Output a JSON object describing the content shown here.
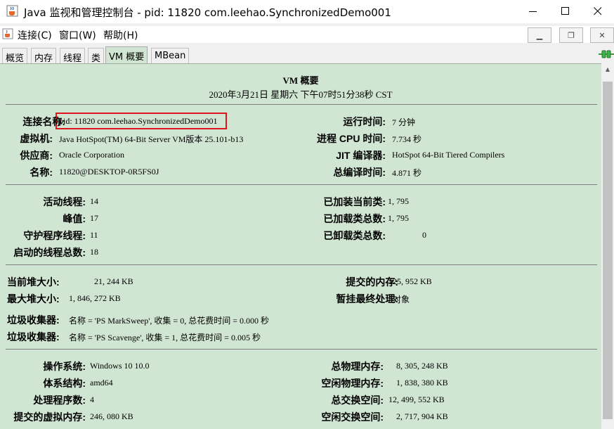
{
  "window": {
    "title": "Java 监视和管理控制台 - pid: 11820 com.leehao.SynchronizedDemo001"
  },
  "menu": {
    "connect": "连接(C)",
    "window": "窗口(W)",
    "help": "帮助(H)"
  },
  "tabs": [
    "概览",
    "内存",
    "线程",
    "类",
    "VM 概要",
    "MBean"
  ],
  "header": {
    "title": "VM 概要",
    "timestamp": "2020年3月21日 星期六 下午07时51分38秒 CST"
  },
  "vm": {
    "connection_label": "连接名称:",
    "connection": "pid: 11820 com.leehao.SynchronizedDemo001",
    "jvm_label": "虚拟机:",
    "jvm": "Java HotSpot(TM) 64-Bit Server VM版本 25.101-b13",
    "vendor_label": "供应商:",
    "vendor": "Oracle Corporation",
    "name_label": "名称:",
    "name": "11820@DESKTOP-0R5FS0J",
    "uptime_label": "运行时间:",
    "uptime": "7 分钟",
    "cpu_label": "进程 CPU 时间:",
    "cpu": "7.734 秒",
    "jit_label": "JIT 编译器:",
    "jit": "HotSpot 64-Bit Tiered Compilers",
    "compile_label": "总编译时间:",
    "compile": "4.871 秒"
  },
  "threads": {
    "live_label": "活动线程:",
    "live": "14",
    "peak_label": "峰值:",
    "peak": "17",
    "daemon_label": "守护程序线程:",
    "daemon": "11",
    "started_label": "启动的线程总数:",
    "started": "18",
    "loaded_label": "已加装当前类:",
    "loaded": "1, 795",
    "total_loaded_label": "已加载类总数:",
    "total_loaded": "1, 795",
    "unloaded_label": "已卸载类总数:",
    "unloaded": "0"
  },
  "memory": {
    "heap_label": "当前堆大小:",
    "heap": "21, 244 KB",
    "max_heap_label": "最大堆大小:",
    "max_heap": "1, 846, 272 KB",
    "committed_label": "提交的内存:",
    "committed": "125, 952 KB",
    "pending_label": "暂挂最终处理:",
    "pending": "0对象",
    "gc1_label": "垃圾收集器:",
    "gc1": "名称 = 'PS MarkSweep', 收集 = 0, 总花费时间 = 0.000 秒",
    "gc2_label": "垃圾收集器:",
    "gc2": "名称 = 'PS Scavenge', 收集 = 1, 总花费时间 = 0.005 秒"
  },
  "os": {
    "os_label": "操作系统:",
    "os": "Windows 10 10.0",
    "arch_label": "体系结构:",
    "arch": "amd64",
    "cpus_label": "处理程序数:",
    "cpus": "4",
    "vmem_label": "提交的虚拟内存:",
    "vmem": "246, 080 KB",
    "phys_label": "总物理内存:",
    "phys": "8, 305, 248 KB",
    "free_phys_label": "空闲物理内存:",
    "free_phys": "1, 838, 380 KB",
    "swap_label": "总交换空间:",
    "swap": "12, 499, 552 KB",
    "free_swap_label": "空闲交换空间:",
    "free_swap": "2, 717, 904 KB"
  },
  "icons": {
    "app": "java-cup-icon",
    "connection": "connection-plug-icon"
  },
  "colors": {
    "panel_bg": "#d1e6d2",
    "highlight": "#e0121b"
  }
}
